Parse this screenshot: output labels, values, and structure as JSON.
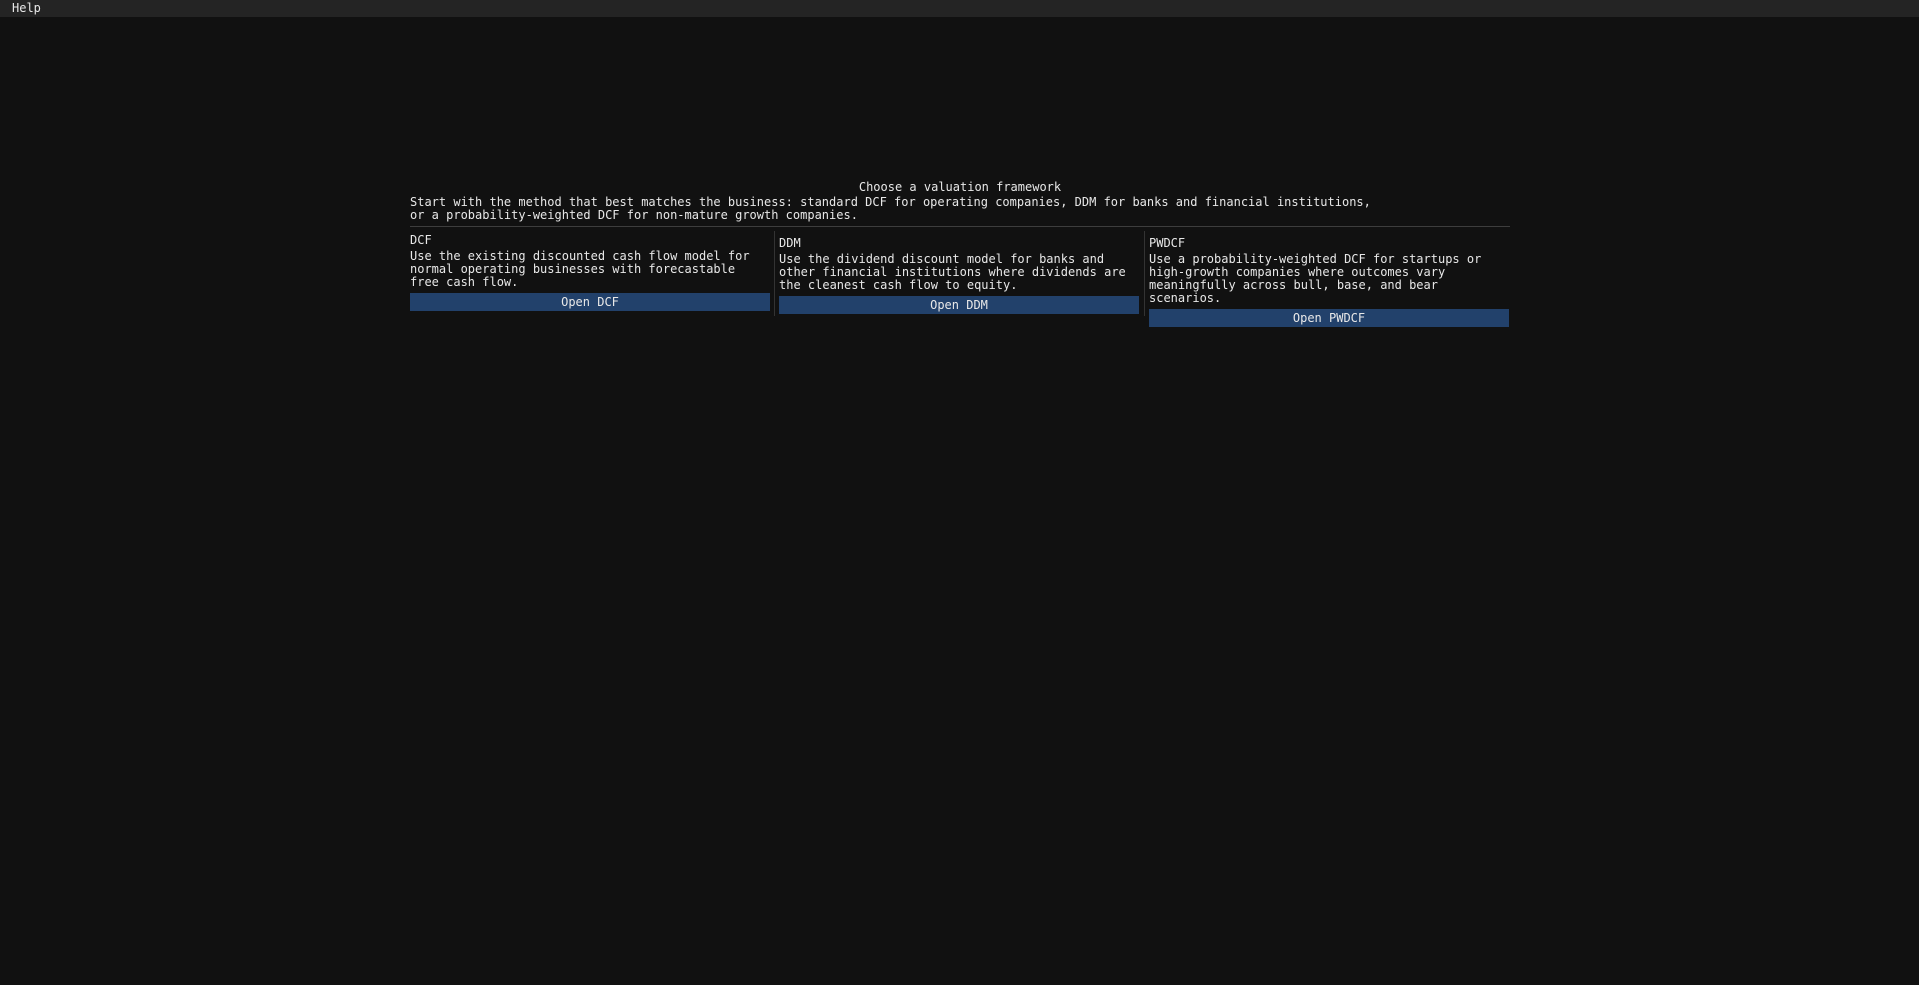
{
  "menubar": {
    "items": [
      {
        "label": "Help"
      }
    ]
  },
  "chooser": {
    "heading": "Choose a valuation framework",
    "subtitle": "Start with the method that best matches the business: standard DCF for operating companies, DDM for banks and financial institutions, or a probability-weighted DCF for non-mature growth companies.",
    "frameworks": [
      {
        "title": "DCF",
        "description": "Use the existing discounted cash flow model for normal operating businesses with forecastable free cash flow.",
        "button_label": "Open DCF"
      },
      {
        "title": "DDM",
        "description": "Use the dividend discount model for banks and other financial institutions where dividends are the cleanest cash flow to equity.",
        "button_label": "Open DDM"
      },
      {
        "title": "PWDCF",
        "description": "Use a probability-weighted DCF for startups or high-growth companies where outcomes vary meaningfully across bull, base, and bear scenarios.",
        "button_label": "Open PWDCF"
      }
    ]
  },
  "colors": {
    "background": "#111111",
    "menubar": "#242424",
    "button": "#22416b",
    "text": "#e8e8e8"
  }
}
